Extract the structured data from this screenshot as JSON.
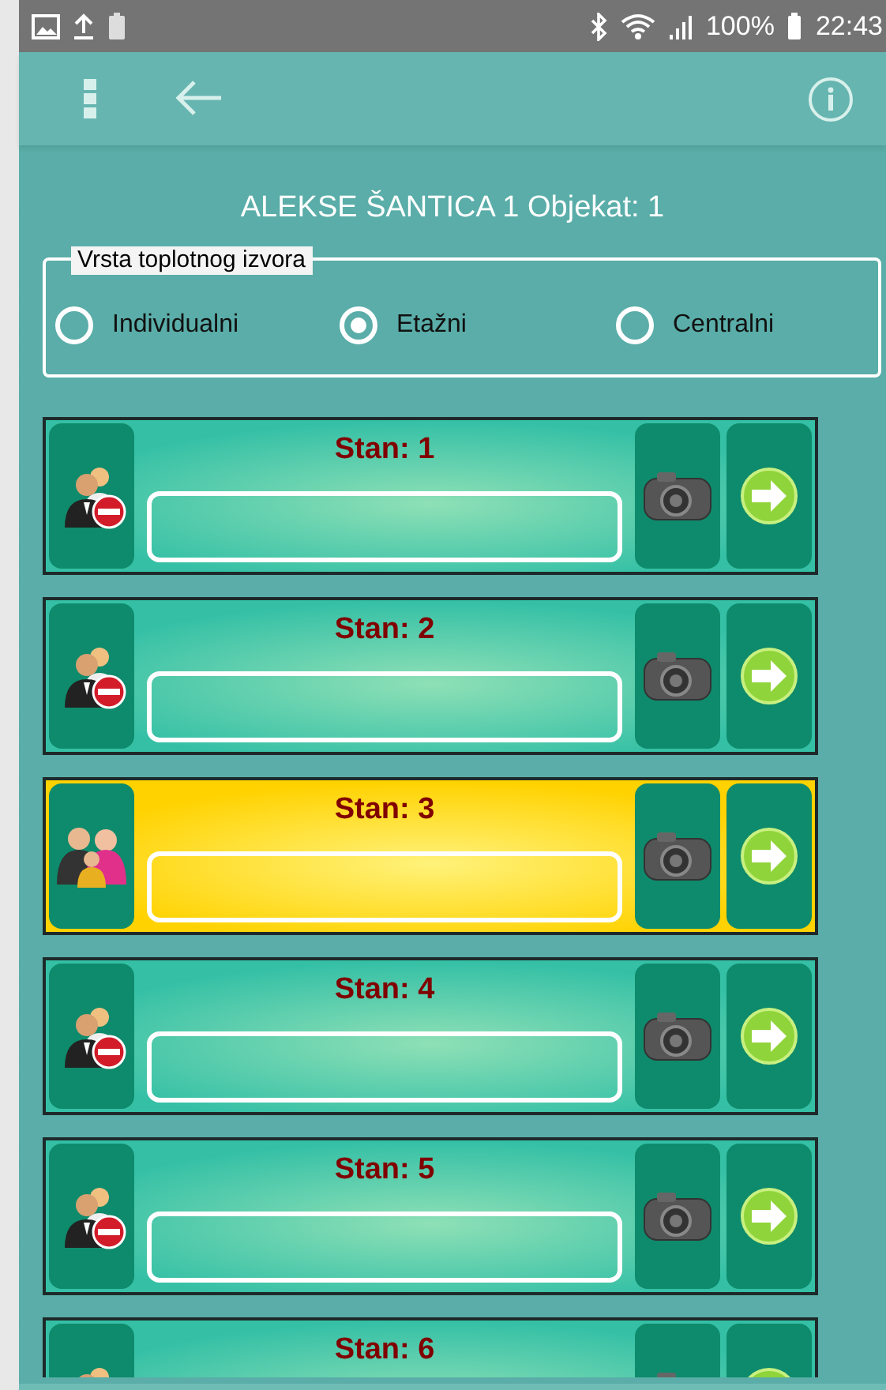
{
  "status_bar": {
    "battery_text": "100%",
    "time": "22:43"
  },
  "toolbar": {
    "title": "ALEKSE ŠANTICA 1 Objekat: 1"
  },
  "heat_source": {
    "legend": "Vrsta toplotnog izvora",
    "options": [
      {
        "label": "Individualni",
        "selected": false
      },
      {
        "label": "Etažni",
        "selected": true
      },
      {
        "label": "Centralni",
        "selected": false
      }
    ]
  },
  "apartments": [
    {
      "title": "Stan: 1",
      "kind": "removed",
      "selected": false
    },
    {
      "title": "Stan: 2",
      "kind": "removed",
      "selected": false
    },
    {
      "title": "Stan: 3",
      "kind": "family",
      "selected": true
    },
    {
      "title": "Stan: 4",
      "kind": "removed",
      "selected": false
    },
    {
      "title": "Stan: 5",
      "kind": "removed",
      "selected": false
    },
    {
      "title": "Stan: 6",
      "kind": "removed",
      "selected": false
    }
  ]
}
